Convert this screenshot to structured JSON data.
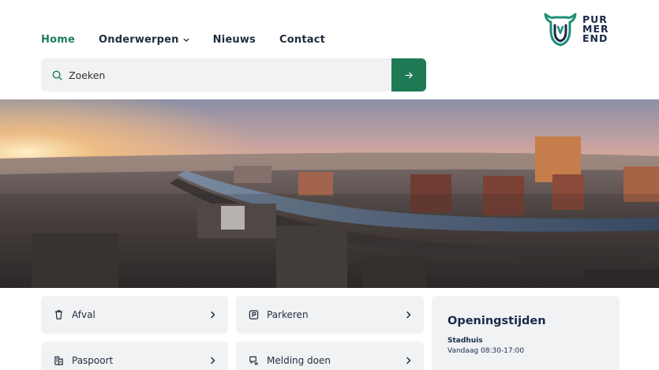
{
  "header": {
    "nav": [
      {
        "label": "Home",
        "active": true
      },
      {
        "label": "Onderwerpen",
        "has_dropdown": true
      },
      {
        "label": "Nieuws"
      },
      {
        "label": "Contact"
      }
    ],
    "logo": {
      "lines": [
        "PUR",
        "MER",
        "END"
      ]
    }
  },
  "search": {
    "placeholder": "Zoeken",
    "icon": "search-icon",
    "button_icon": "arrow-right-icon"
  },
  "hero": {
    "description_icon": "aerial-city-photo"
  },
  "quick_links": [
    {
      "label": "Afval",
      "icon": "trash-icon"
    },
    {
      "label": "Parkeren",
      "icon": "parking-icon"
    },
    {
      "label": "Paspoort",
      "icon": "passport-icon"
    },
    {
      "label": "Melding doen",
      "icon": "report-icon"
    }
  ],
  "opening_hours": {
    "title": "Openingstijden",
    "location": "Stadhuis",
    "today": "Vandaag 08:30-17:00"
  },
  "colors": {
    "brand_green": "#1e7a55",
    "nav_active": "#1e7f5c",
    "text_dark": "#1b2a4a",
    "card_bg": "#f1f2f4"
  }
}
